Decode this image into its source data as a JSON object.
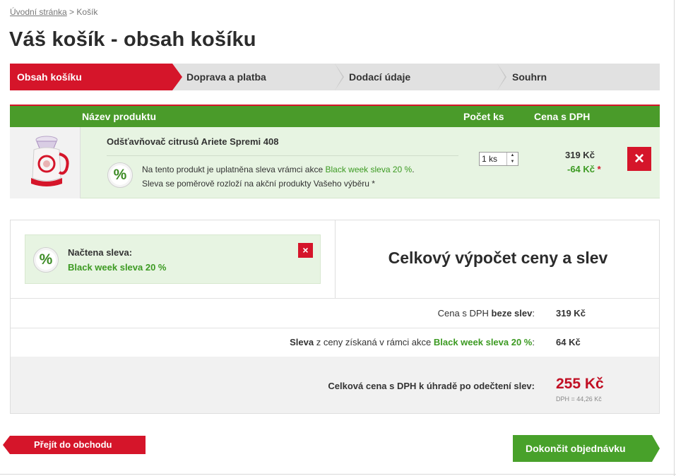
{
  "breadcrumb": {
    "home": "Úvodní stránka",
    "sep": " > ",
    "current": "Košík"
  },
  "page_title": "Váš košík - obsah košíku",
  "steps": [
    "Obsah košíku",
    "Doprava a platba",
    "Dodací údaje",
    "Souhrn"
  ],
  "table": {
    "col_product": "Název produktu",
    "col_qty": "Počet ks",
    "col_price": "Cena s DPH"
  },
  "product": {
    "name": "Odšťavňovač citrusů Ariete Spremi 408",
    "note_prefix": "Na tento produkt je uplatněna sleva vrámci akce ",
    "note_promo": "Black week sleva 20 %",
    "note_suffix": ".",
    "note_line2": "Sleva se poměrově rozloží na akční produkty Vašeho výběru *",
    "qty": "1 ks",
    "price": "319 Kč",
    "discount": "-64 Kč",
    "discount_mark": "*"
  },
  "discount_box": {
    "icon": "%",
    "title": "Načtena sleva:",
    "name": "Black week sleva 20 %",
    "remove": "×"
  },
  "summary": {
    "heading": "Celkový výpočet ceny a slev",
    "line1_label_a": "Cena s DPH ",
    "line1_label_b": "beze slev",
    "line1_label_c": ":",
    "line1_value": "319 Kč",
    "line2_label_a": "Sleva",
    "line2_label_b": " z ceny získaná v rámci akce ",
    "line2_label_c": "Black week sleva 20 %",
    "line2_label_d": ":",
    "line2_value": "64 Kč",
    "total_label": "Celková cena s DPH k úhradě po odečtení slev:",
    "total_value": "255 Kč",
    "total_vat": "DPH = 44,26 Kč"
  },
  "buttons": {
    "back": "Přejít do obchodu",
    "finish": "Dokončit objednávku"
  },
  "icons": {
    "remove": "×",
    "percent": "%"
  },
  "colors": {
    "brand_red": "#d5152a",
    "brand_green": "#4a9b2a",
    "total_red": "#c10f24"
  }
}
